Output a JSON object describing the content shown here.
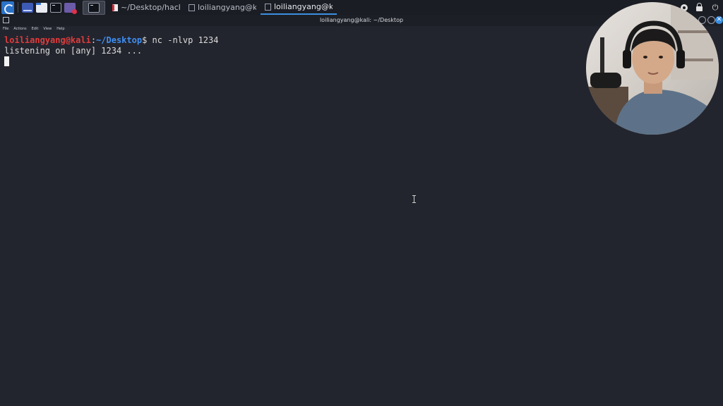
{
  "taskbar": {
    "launcher_icon": "kali-dragon-icon",
    "apps": [
      "desktop-icon",
      "file-manager-icon",
      "terminal-icon",
      "screen-recorder-icon"
    ],
    "tasks": [
      {
        "label": "~/Desktop/hacke...",
        "icon": "document-icon",
        "active": false
      },
      {
        "label": "loiliangyang@kali...",
        "icon": "terminal-icon",
        "active": false
      },
      {
        "label": "loiliangyang@kali...",
        "icon": "terminal-icon",
        "active": true
      }
    ]
  },
  "window": {
    "title": "loiliangyang@kali: ~/Desktop",
    "close_glyph": "✕"
  },
  "menu": {
    "file": "File",
    "actions": "Actions",
    "edit": "Edit",
    "view": "View",
    "help": "Help"
  },
  "terminal": {
    "prompt_user": "loiliangyang@kali",
    "prompt_sep": ":",
    "prompt_path": "~/Desktop",
    "prompt_end": "$ ",
    "command": "nc -nlvp 1234",
    "output": "listening on [any] 1234 ..."
  },
  "colors": {
    "background": "#23252e",
    "prompt_user": "#e03c3c",
    "prompt_path": "#3f8ff2",
    "accent": "#3b8fe0"
  }
}
